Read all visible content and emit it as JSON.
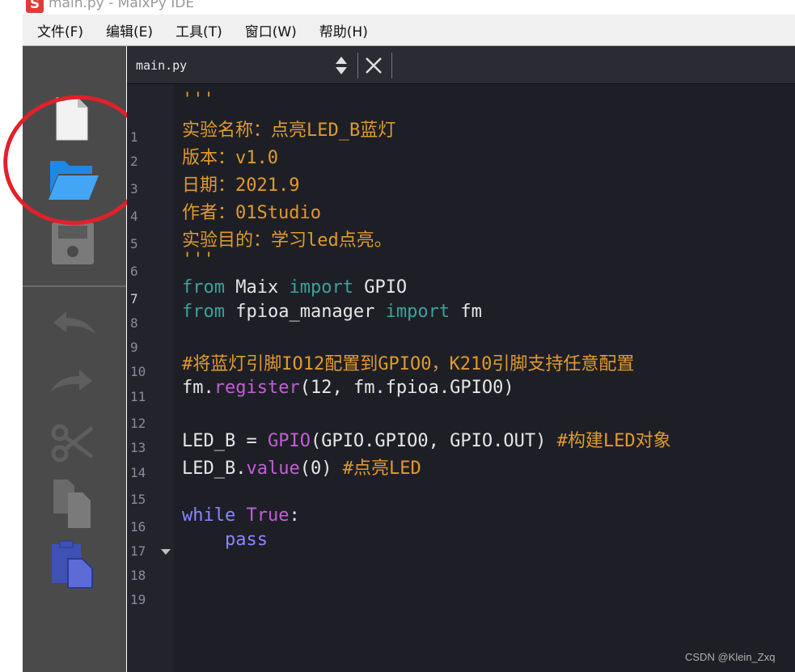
{
  "window": {
    "title": "main.py - MaixPy IDE",
    "logo_letter": "S"
  },
  "menu": [
    {
      "label": "文件(F)"
    },
    {
      "label": "编辑(E)"
    },
    {
      "label": "工具(T)"
    },
    {
      "label": "窗口(W)"
    },
    {
      "label": "帮助(H)"
    }
  ],
  "toolbar": {
    "buttons": [
      "new-file-icon",
      "open-folder-icon",
      "save-icon",
      "undo-icon",
      "redo-icon",
      "cut-icon",
      "copy-icon",
      "paste-icon"
    ],
    "annotation_color": "#e3202a"
  },
  "editor": {
    "tab": {
      "filename": "main.py"
    },
    "current_line": "7",
    "line_numbers": [
      "1",
      "2",
      "3",
      "4",
      "5",
      "6",
      "7",
      "8",
      "9",
      "10",
      "11",
      "12",
      "13",
      "14",
      "15",
      "16",
      "17",
      "18",
      "19"
    ],
    "code": {
      "l1": "'''",
      "l2": "实验名称：点亮LED_B蓝灯",
      "l3": "版本：v1.0",
      "l4": "日期：2021.9",
      "l5": "作者：01Studio",
      "l6": "实验目的：学习led点亮。",
      "l7": "'''",
      "l8_kw1": "from",
      "l8_mod": " Maix ",
      "l8_kw2": "import",
      "l8_name": " GPIO",
      "l9_kw1": "from",
      "l9_mod": " fpioa_manager ",
      "l9_kw2": "import",
      "l9_name": " fm",
      "l11": "#将蓝灯引脚IO12配置到GPIO0，K210引脚支持任意配置",
      "l12_obj": "fm.",
      "l12_fn": "register",
      "l12_args": "(12, fm.fpioa.GPIO0)",
      "l14_var": "LED_B = ",
      "l14_fn": "GPIO",
      "l14_args": "(GPIO.GPIO0, GPIO.OUT) ",
      "l14_comment": "#构建LED对象",
      "l15_var": "LED_B.",
      "l15_fn": "value",
      "l15_args": "(0) ",
      "l15_comment": "#点亮LED",
      "l17_kw": "while",
      "l17_true": " True",
      "l17_colon": ":",
      "l18": "    pass"
    }
  },
  "watermark": "CSDN @Klein_Zxq"
}
